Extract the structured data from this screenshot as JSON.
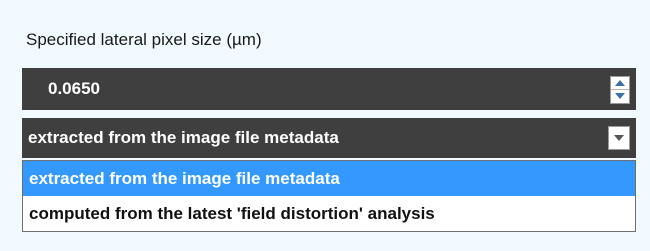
{
  "pixel_size": {
    "label": "Specified lateral pixel size (µm)",
    "value": "0.0650"
  },
  "source_select": {
    "selected": "extracted from the image file metadata",
    "options": [
      "extracted from the image file metadata",
      "computed from the latest 'field distortion' analysis"
    ],
    "highlighted_index": 0
  },
  "colors": {
    "background": "#f0faff",
    "field_background": "#3f3f3f",
    "highlight": "#3399ff"
  },
  "icons": {
    "spin_up": "triangle-up-icon",
    "spin_down": "triangle-down-icon",
    "dropdown": "chevron-down-icon"
  }
}
